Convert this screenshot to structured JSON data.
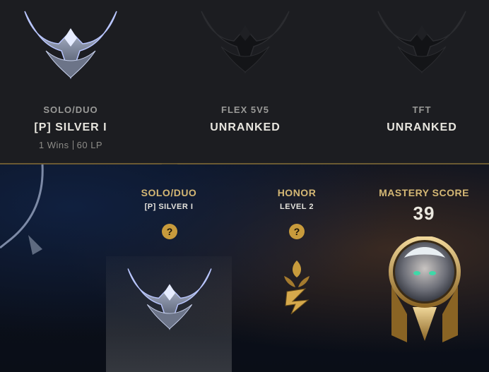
{
  "ranked": [
    {
      "queue": "SOLO/DUO",
      "tier": "[P] SILVER I",
      "wins": "1 Wins",
      "lp": "60 LP",
      "crest": "silver-crest-icon"
    },
    {
      "queue": "FLEX 5V5",
      "tier": "UNRANKED",
      "crest": "unranked-crest-icon"
    },
    {
      "queue": "TFT",
      "tier": "UNRANKED",
      "crest": "unranked-crest-icon"
    }
  ],
  "highlights": {
    "solo": {
      "title": "SOLO/DUO",
      "sub": "[P] SILVER I",
      "help": "?"
    },
    "honor": {
      "title": "HONOR",
      "sub": "LEVEL 2",
      "help": "?"
    },
    "mastery": {
      "title": "MASTERY SCORE",
      "score": "39"
    }
  },
  "colors": {
    "gold": "#c89b3c",
    "gold_text": "#d4b774",
    "bg_top": "#1c1d21"
  }
}
